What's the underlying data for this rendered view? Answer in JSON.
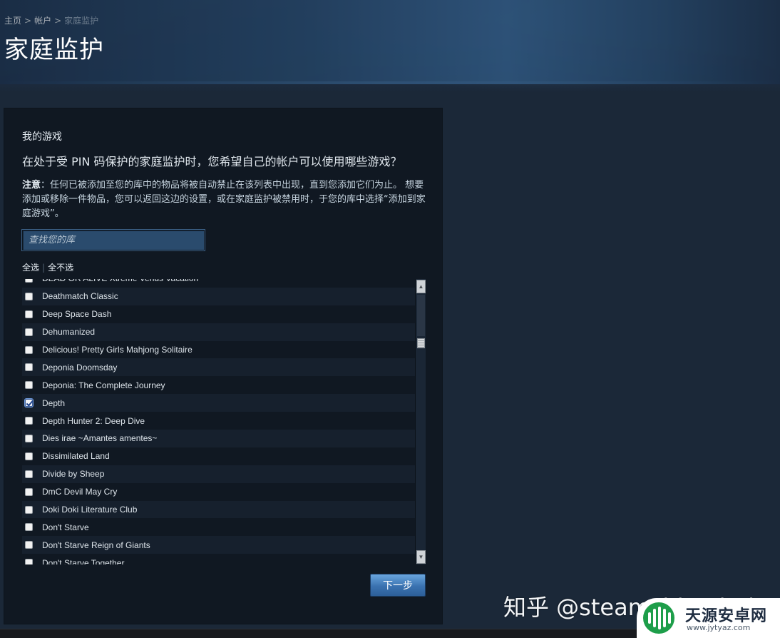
{
  "breadcrumb": {
    "home": "主页",
    "account": "帐户",
    "current": "家庭监护",
    "separator": ">"
  },
  "page": {
    "title": "家庭监护"
  },
  "panel": {
    "section_title": "我的游戏",
    "question": "在处于受 PIN 码保护的家庭监护时，您希望自己的帐户可以使用哪些游戏？",
    "note_label": "注意",
    "note_text": "：任何已被添加至您的库中的物品将被自动禁止在该列表中出现，直到您添加它们为止。 想要添加或移除一件物品，您可以返回这边的设置，或在家庭监护被禁用时，于您的库中选择“添加到家庭游戏”。",
    "search_placeholder": "查找您的库",
    "select_all": "全选",
    "select_none": "全不选",
    "next_button": "下一步"
  },
  "games": [
    {
      "name": "DEAD OR ALIVE Xtreme Venus Vacation",
      "checked": false
    },
    {
      "name": "Deathmatch Classic",
      "checked": false
    },
    {
      "name": "Deep Space Dash",
      "checked": false
    },
    {
      "name": "Dehumanized",
      "checked": false
    },
    {
      "name": "Delicious! Pretty Girls Mahjong Solitaire",
      "checked": false
    },
    {
      "name": "Deponia Doomsday",
      "checked": false
    },
    {
      "name": "Deponia: The Complete Journey",
      "checked": false
    },
    {
      "name": "Depth",
      "checked": true
    },
    {
      "name": "Depth Hunter 2: Deep Dive",
      "checked": false
    },
    {
      "name": "Dies irae ~Amantes amentes~",
      "checked": false
    },
    {
      "name": "Dissimilated Land",
      "checked": false
    },
    {
      "name": "Divide by Sheep",
      "checked": false
    },
    {
      "name": "DmC Devil May Cry",
      "checked": false
    },
    {
      "name": "Doki Doki Literature Club",
      "checked": false
    },
    {
      "name": "Don't Starve",
      "checked": false
    },
    {
      "name": "Don't Starve Reign of Giants",
      "checked": false
    },
    {
      "name": "Don't Starve Together",
      "checked": false
    }
  ],
  "scrollbar": {
    "up_icon": "▲",
    "down_icon": "▼"
  },
  "watermark": {
    "text": "知乎 @steamchina.hub",
    "brand_name": "天源安卓网",
    "brand_url": "www.jytyaz.com"
  },
  "colors": {
    "accent_button": "#3a72b0",
    "panel_bg": "#101822",
    "page_bg": "#1b2838"
  }
}
